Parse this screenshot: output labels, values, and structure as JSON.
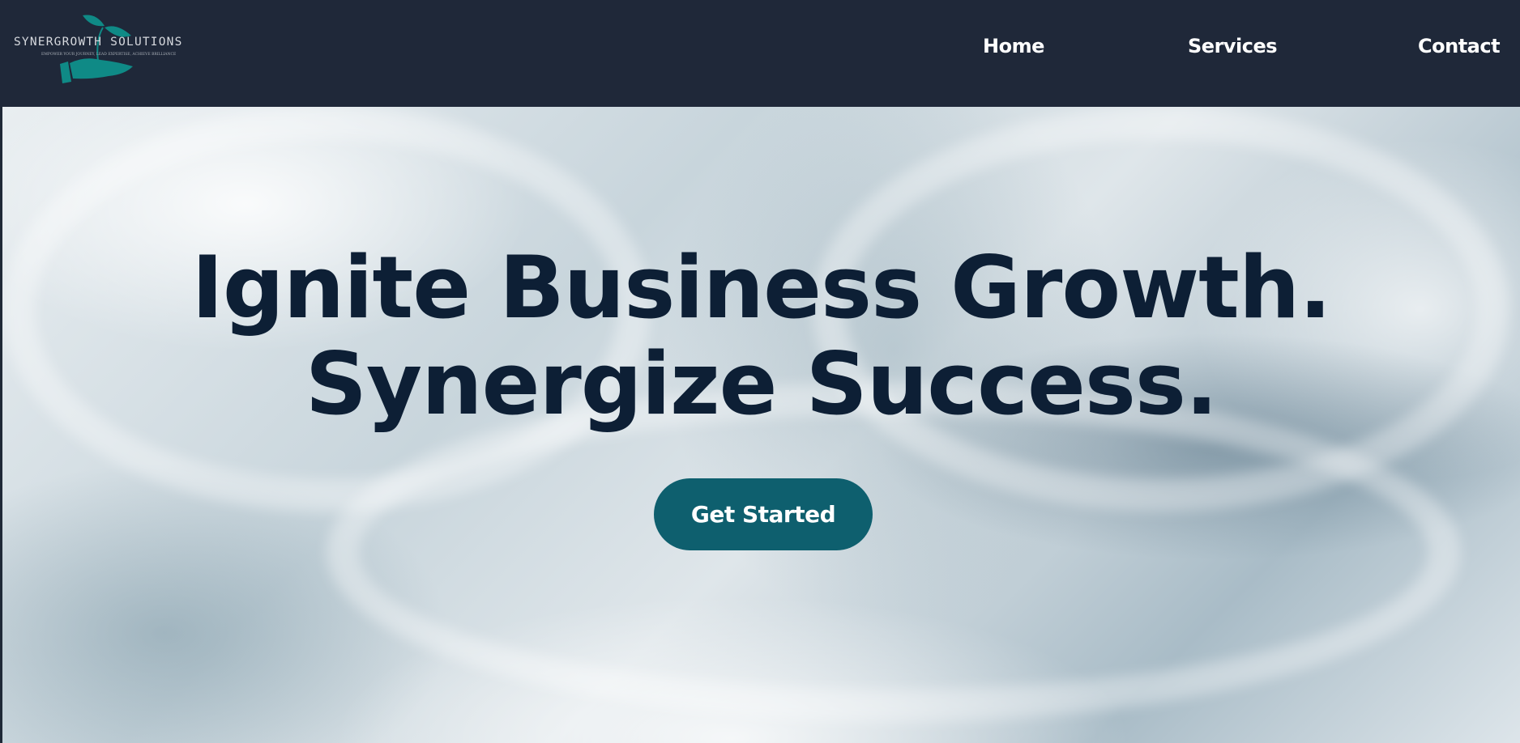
{
  "brand": {
    "name": "SYNERGROWTH SOLUTIONS",
    "tagline": "EMPOWER YOUR JOURNEY, LEAD EXPERTISE, ACHIEVE BRILLIANCE"
  },
  "nav": {
    "items": [
      {
        "label": "Home"
      },
      {
        "label": "Services"
      },
      {
        "label": "Contact"
      }
    ]
  },
  "hero": {
    "line1": "Ignite Business Growth.",
    "line2": "Synergize Success.",
    "cta_label": "Get Started"
  },
  "colors": {
    "header": "#1f2839",
    "accent": "#0e5f6e",
    "heading": "#0d1f35",
    "logo": "#0f8a86"
  }
}
